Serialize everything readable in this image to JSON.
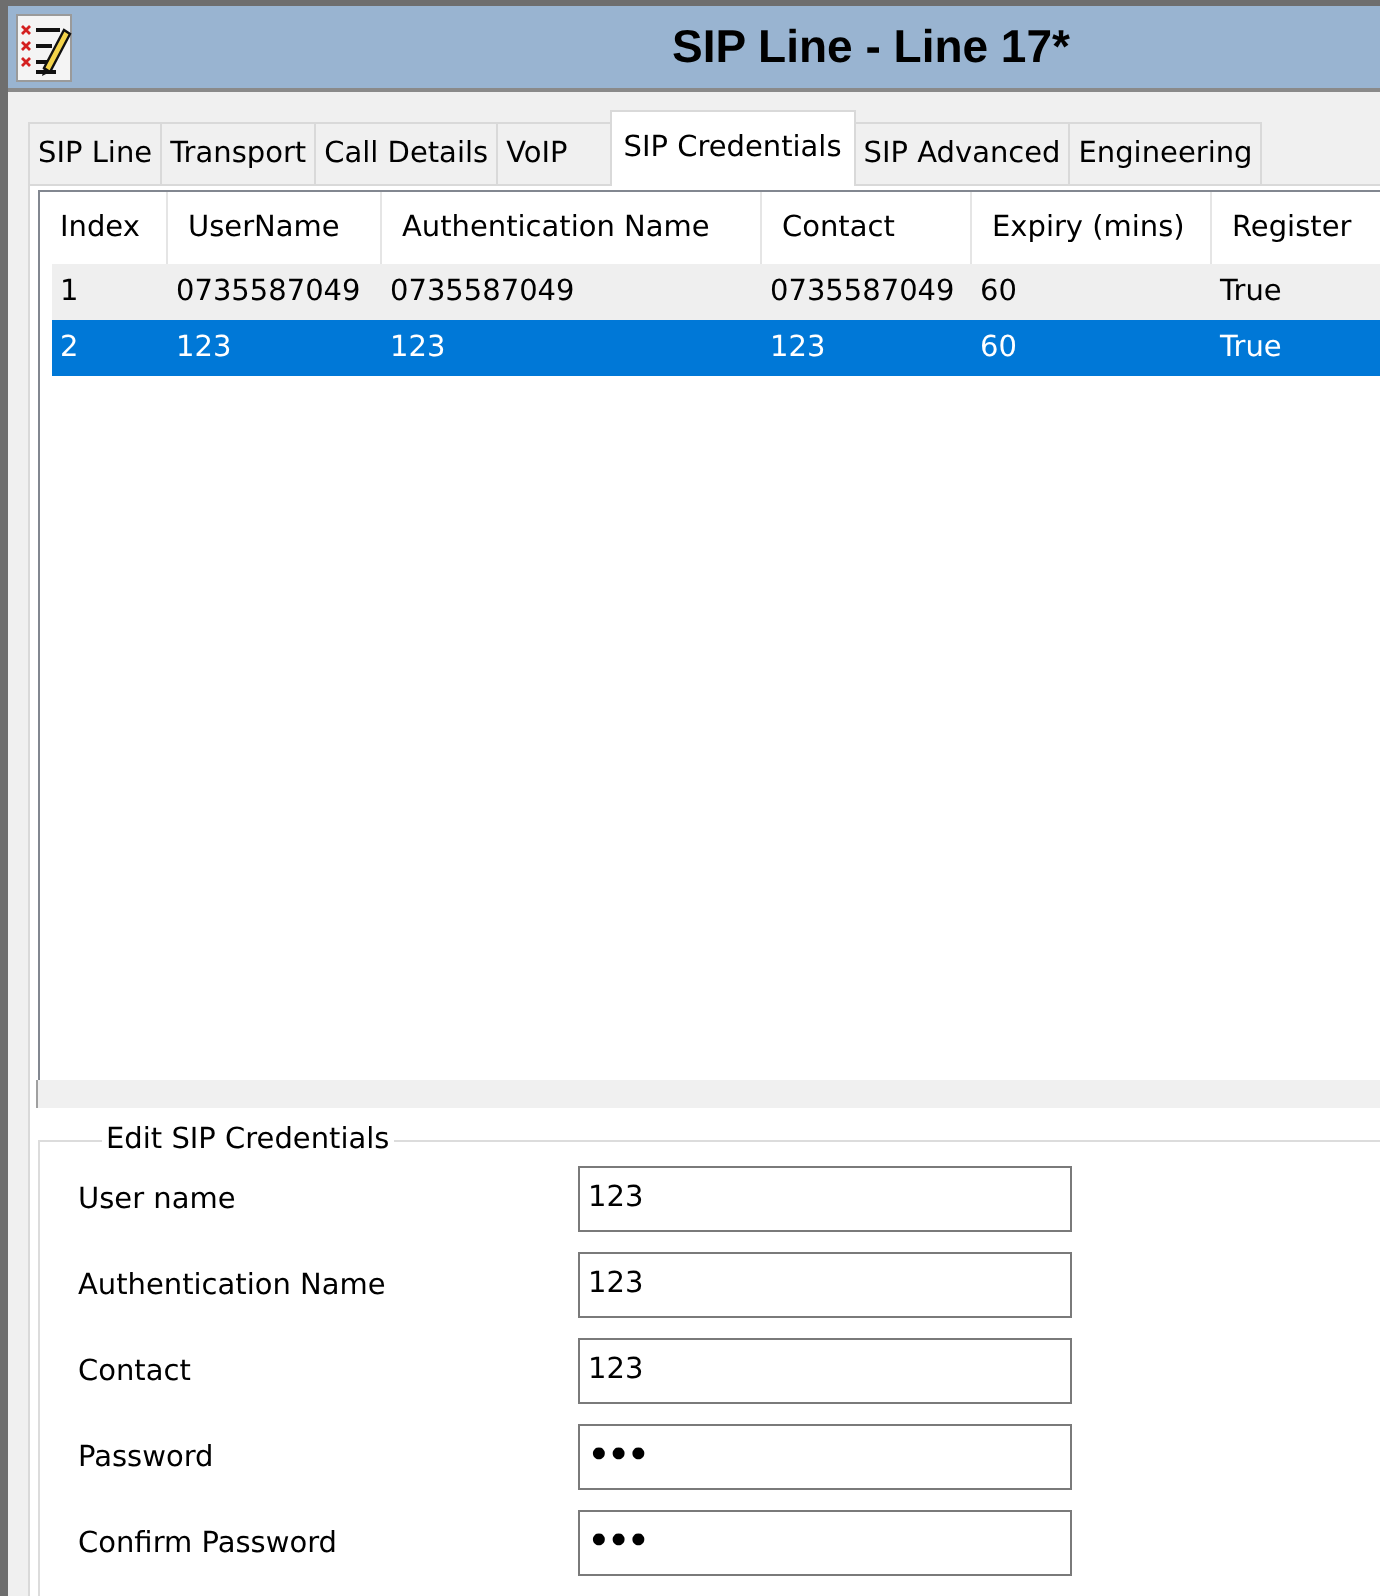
{
  "window": {
    "title": "SIP Line - Line 17*"
  },
  "tabs": [
    {
      "label": "SIP Line",
      "selected": false
    },
    {
      "label": "Transport",
      "selected": false
    },
    {
      "label": "Call Details",
      "selected": false
    },
    {
      "label": "VoIP",
      "selected": false
    },
    {
      "label": "SIP Credentials",
      "selected": true
    },
    {
      "label": "SIP Advanced",
      "selected": false
    },
    {
      "label": "Engineering",
      "selected": false
    }
  ],
  "table": {
    "columns": [
      "Index",
      "UserName",
      "Authentication Name",
      "Contact",
      "Expiry (mins)",
      "Register"
    ],
    "rows": [
      {
        "cells": [
          "1",
          "0735587049",
          "0735587049",
          "0735587049",
          "60",
          "True"
        ],
        "selected": false
      },
      {
        "cells": [
          "2",
          "123",
          "123",
          "123",
          "60",
          "True"
        ],
        "selected": true
      }
    ]
  },
  "edit_group": {
    "title": "Edit SIP Credentials",
    "fields": [
      {
        "label": "User name",
        "value": "123",
        "kind": "text"
      },
      {
        "label": "Authentication Name",
        "value": "123",
        "kind": "text"
      },
      {
        "label": "Contact",
        "value": "123",
        "kind": "text"
      },
      {
        "label": "Password",
        "value": "•••",
        "kind": "password"
      },
      {
        "label": "Confirm Password",
        "value": "•••",
        "kind": "password"
      }
    ]
  }
}
